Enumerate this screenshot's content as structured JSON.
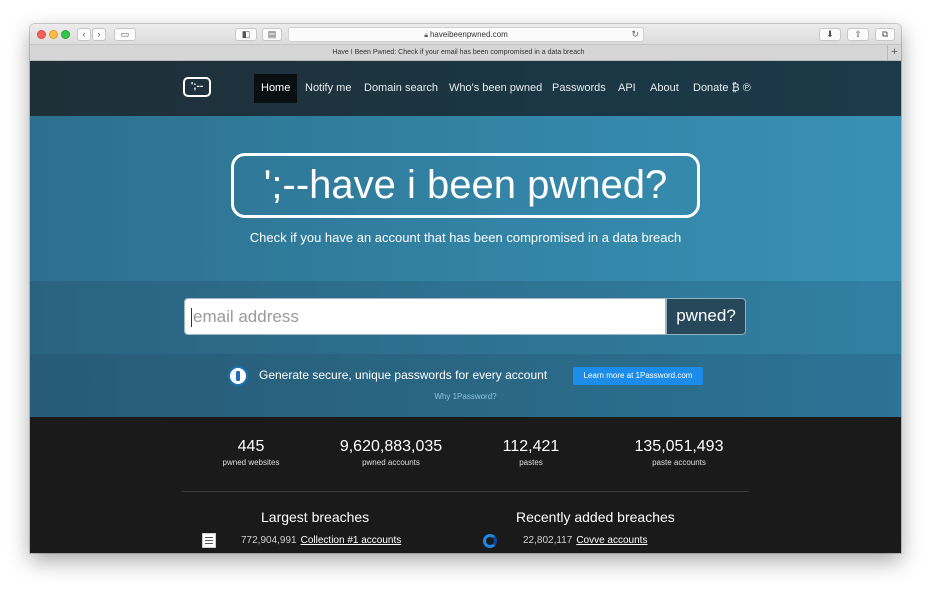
{
  "browser": {
    "url": "haveibeenpwned.com",
    "tab_title": "Have I Been Pwned: Check if your email has been compromised in a data breach",
    "new_tab": "+"
  },
  "nav": {
    "logo": "';--",
    "items": [
      "Home",
      "Notify me",
      "Domain search",
      "Who's been pwned",
      "Passwords",
      "API",
      "About",
      "Donate ₿ ℗"
    ],
    "active": "Home"
  },
  "hero": {
    "title": "';--have i been pwned?",
    "subtitle": "Check if you have an account that has been compromised in a data breach"
  },
  "search": {
    "placeholder": "email address",
    "button": "pwned?"
  },
  "promo": {
    "text": "Generate secure, unique passwords for every account",
    "button": "Learn more at 1Password.com",
    "link": "Why 1Password?"
  },
  "stats": [
    {
      "value": "445",
      "label": "pwned websites"
    },
    {
      "value": "9,620,883,035",
      "label": "pwned accounts"
    },
    {
      "value": "112,421",
      "label": "pastes"
    },
    {
      "value": "135,051,493",
      "label": "paste accounts"
    }
  ],
  "largest_breaches": {
    "heading": "Largest breaches",
    "rows": [
      {
        "count": "772,904,991",
        "name": "Collection #1 accounts"
      }
    ]
  },
  "recent_breaches": {
    "heading": "Recently added breaches",
    "rows": [
      {
        "count": "22,802,117",
        "name": "Covve accounts"
      }
    ]
  },
  "colors": {
    "nav_bg": "#1b3644",
    "hero_bg": "#3384a6",
    "search_button": "#26485a",
    "promo_button": "#1d8be8",
    "stats_bg": "#1a1a1a"
  }
}
